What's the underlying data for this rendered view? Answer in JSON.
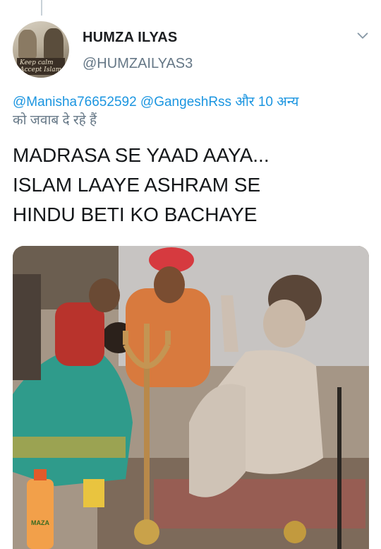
{
  "tweet": {
    "display_name": "HUMZA ILYAS",
    "handle": "@HUMZAILYAS3",
    "avatar_sign_text": "Keep calm Accept Islam",
    "reply_context": {
      "mention_1": "@Manisha76652592",
      "mention_2": "@GangeshRss",
      "connector": "और",
      "others": "10 अन्य",
      "suffix": "को जवाब दे रहे हैं"
    },
    "text_lines": [
      "MADRASA SE YAAD AAYA...",
      "ISLAM LAAYE ASHRAM SE",
      "HINDU BETI KO BACHAYE"
    ],
    "media": {
      "bottle_label": "MAZA"
    }
  },
  "colors": {
    "link": "#1b95e0",
    "secondary_text": "#657786",
    "primary_text": "#14171a"
  },
  "icons": {
    "menu": "chevron-down-icon"
  }
}
